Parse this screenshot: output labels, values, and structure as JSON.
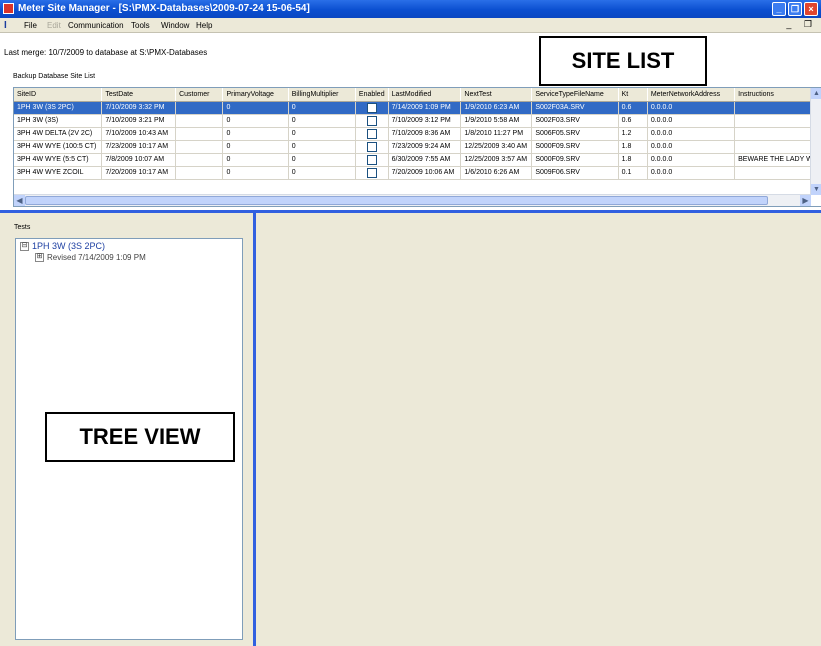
{
  "window": {
    "title": "Meter Site Manager - [S:\\PMX-Databases\\2009-07-24 15-06-54]"
  },
  "menu": {
    "items": [
      {
        "label": "File",
        "disabled": false
      },
      {
        "label": "Edit",
        "disabled": true
      },
      {
        "label": "Communication",
        "disabled": false
      },
      {
        "label": "Tools",
        "disabled": false
      },
      {
        "label": "Window",
        "disabled": false
      },
      {
        "label": "Help",
        "disabled": false
      }
    ]
  },
  "status": {
    "last_merge": "Last merge: 10/7/2009 to database at S:\\PMX-Databases"
  },
  "site_list": {
    "label": "Backup Database Site List",
    "columns": [
      "SiteID",
      "TestDate",
      "Customer",
      "PrimaryVoltage",
      "BillingMultiplier",
      "Enabled",
      "LastModified",
      "NextTest",
      "ServiceTypeFileName",
      "Kt",
      "MeterNetworkAddress",
      "Instructions"
    ],
    "rows": [
      {
        "site_id": "1PH 3W (3S 2PC)",
        "test_date": "7/10/2009 3:32 PM",
        "customer": "",
        "primary_voltage": "0",
        "billing_multiplier": "0",
        "enabled": false,
        "last_modified": "7/14/2009 1:09 PM",
        "next_test": "1/9/2010 6:23 AM",
        "service_type_file": "S002F03A.SRV",
        "kt": "0.6",
        "meter_network_address": "0.0.0.0",
        "instructions": "",
        "selected": true
      },
      {
        "site_id": "1PH 3W (3S)",
        "test_date": "7/10/2009 3:21 PM",
        "customer": "",
        "primary_voltage": "0",
        "billing_multiplier": "0",
        "enabled": false,
        "last_modified": "7/10/2009 3:12 PM",
        "next_test": "1/9/2010 5:58 AM",
        "service_type_file": "S002F03.SRV",
        "kt": "0.6",
        "meter_network_address": "0.0.0.0",
        "instructions": "",
        "selected": false
      },
      {
        "site_id": "3PH 4W DELTA (2V 2C)",
        "test_date": "7/10/2009 10:43 AM",
        "customer": "",
        "primary_voltage": "0",
        "billing_multiplier": "0",
        "enabled": false,
        "last_modified": "7/10/2009 8:36 AM",
        "next_test": "1/8/2010 11:27 PM",
        "service_type_file": "S006F05.SRV",
        "kt": "1.2",
        "meter_network_address": "0.0.0.0",
        "instructions": "",
        "selected": false
      },
      {
        "site_id": "3PH 4W WYE (100:5 CT)",
        "test_date": "7/23/2009 10:17 AM",
        "customer": "",
        "primary_voltage": "0",
        "billing_multiplier": "0",
        "enabled": false,
        "last_modified": "7/23/2009 9:24 AM",
        "next_test": "12/25/2009 3:40 AM",
        "service_type_file": "S000F09.SRV",
        "kt": "1.8",
        "meter_network_address": "0.0.0.0",
        "instructions": "",
        "selected": false
      },
      {
        "site_id": "3PH 4W WYE (5:5 CT)",
        "test_date": "7/8/2009 10:07 AM",
        "customer": "",
        "primary_voltage": "0",
        "billing_multiplier": "0",
        "enabled": false,
        "last_modified": "6/30/2009 7:55 AM",
        "next_test": "12/25/2009 3:57 AM",
        "service_type_file": "S000F09.SRV",
        "kt": "1.8",
        "meter_network_address": "0.0.0.0",
        "instructions": "BEWARE THE LADY WI",
        "selected": false
      },
      {
        "site_id": "3PH 4W WYE ZCOIL",
        "test_date": "7/20/2009 10:17 AM",
        "customer": "",
        "primary_voltage": "0",
        "billing_multiplier": "0",
        "enabled": false,
        "last_modified": "7/20/2009 10:06 AM",
        "next_test": "1/6/2010 6:26 AM",
        "service_type_file": "S009F06.SRV",
        "kt": "0.1",
        "meter_network_address": "0.0.0.0",
        "instructions": "",
        "selected": false
      }
    ]
  },
  "tests": {
    "label": "Tests",
    "root": {
      "expander": "⊟",
      "label": "1PH 3W (3S 2PC)"
    },
    "child": {
      "expander": "⊞",
      "label": "Revised 7/14/2009 1:09 PM"
    }
  },
  "callouts": {
    "site_list": "SITE LIST",
    "tree_view": "TREE VIEW"
  },
  "colors": {
    "title_bar": "#0b4fd0",
    "selection": "#316ac5",
    "splitter": "#3160e0",
    "pane_bg": "#ece9d8"
  }
}
